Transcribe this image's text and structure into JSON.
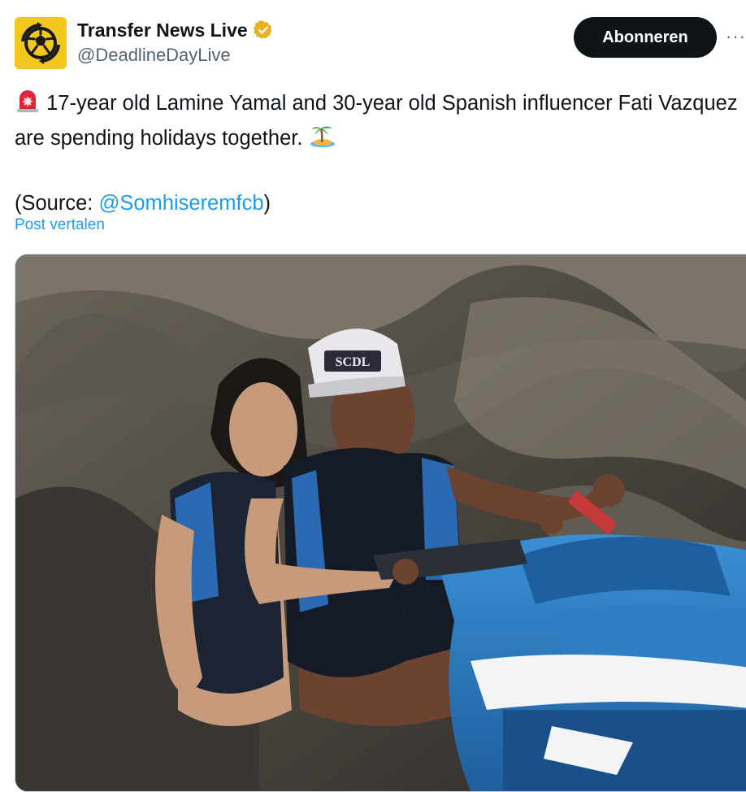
{
  "author": {
    "display_name": "Transfer News Live",
    "handle": "@DeadlineDayLive",
    "avatar_icon": "soccer-ball-logo",
    "verified_icon": "gold-verified-badge"
  },
  "actions": {
    "subscribe_label": "Abonneren",
    "more_label": "···"
  },
  "post": {
    "siren_emoji": "🚨",
    "text_main": "17-year old Lamine Yamal and 30-year old Spanish influencer Fati Vazquez are spending holidays together.",
    "island_emoji": "🏝️",
    "source_prefix": "(Source: ",
    "source_link": "@Somhiseremfcb",
    "source_suffix": ")",
    "translate_label": "Post vertalen"
  },
  "media": {
    "cap_text": "SCDL"
  },
  "colors": {
    "link": "#1d9bf0",
    "button_bg": "#0f1419",
    "avatar_bg": "#f2c81e",
    "verified": "#e8b21d"
  }
}
